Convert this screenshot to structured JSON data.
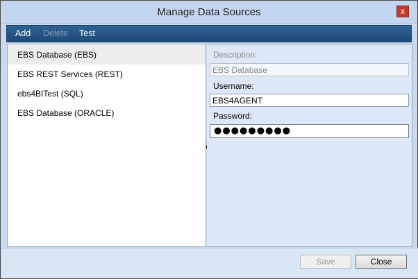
{
  "window": {
    "title": "Manage Data Sources",
    "close_glyph": "x"
  },
  "toolbar": {
    "add_label": "Add",
    "delete_label": "Delete",
    "test_label": "Test"
  },
  "data_sources": [
    {
      "label": "EBS Database (EBS)",
      "selected": true
    },
    {
      "label": "EBS REST Services (REST)",
      "selected": false
    },
    {
      "label": "ebs4BITest (SQL)",
      "selected": false
    },
    {
      "label": "EBS Database (ORACLE)",
      "selected": false
    }
  ],
  "details": {
    "description_label": "Description:",
    "description_value": "EBS Database",
    "username_label": "Username:",
    "username_value": "EBS4AGENT",
    "password_label": "Password:",
    "password_mask": "●●●●●●●●●"
  },
  "footer": {
    "save_label": "Save",
    "close_label": "Close"
  },
  "colors": {
    "toolbar_bg": "#1f4b78",
    "close_button": "#c0392b",
    "detail_panel_bg": "#dde9f8",
    "selected_item_bg": "#ededed"
  }
}
